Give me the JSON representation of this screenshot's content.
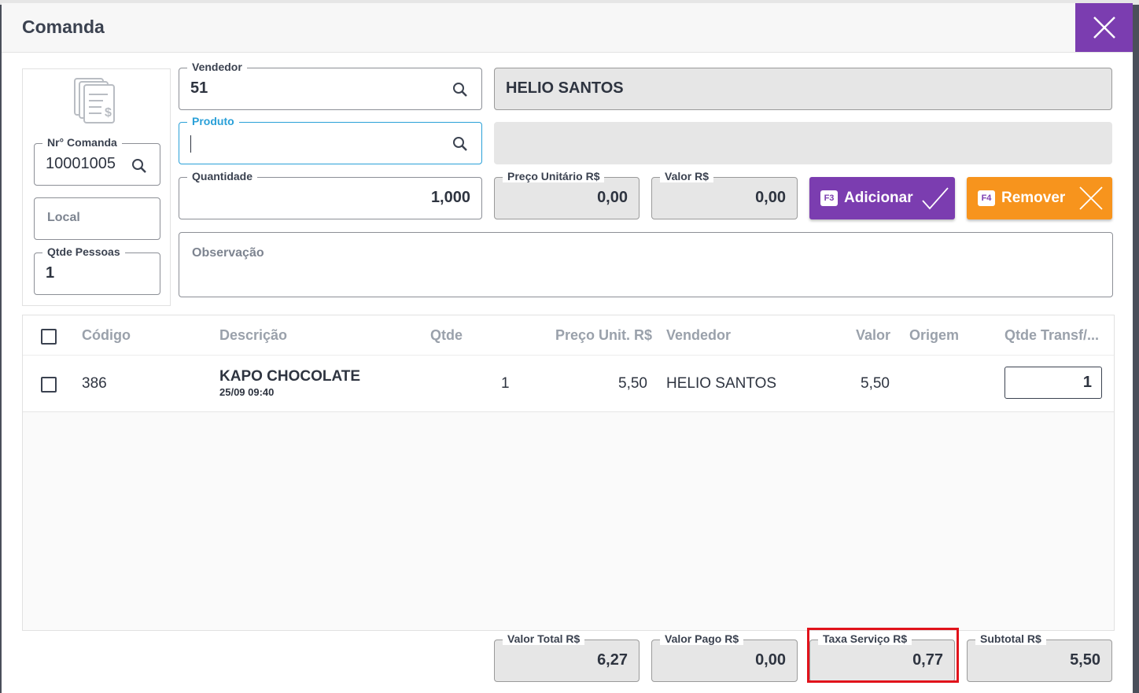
{
  "window": {
    "title": "Comanda"
  },
  "left_panel": {
    "comanda_label": "Nr° Comanda",
    "comanda_value": "10001005",
    "local_placeholder": "Local",
    "pessoas_label": "Qtde Pessoas",
    "pessoas_value": "1"
  },
  "form": {
    "vendedor_label": "Vendedor",
    "vendedor_value": "51",
    "vendedor_name": "HELIO SANTOS",
    "produto_label": "Produto",
    "produto_value": "",
    "produto_desc": "",
    "quantidade_label": "Quantidade",
    "quantidade_value": "1,000",
    "preco_label": "Preço Unitário R$",
    "preco_value": "0,00",
    "valor_label": "Valor R$",
    "valor_value": "0,00",
    "observacao_placeholder": "Observação"
  },
  "buttons": {
    "adicionar_key": "F3",
    "adicionar_label": "Adicionar",
    "remover_key": "F4",
    "remover_label": "Remover"
  },
  "table": {
    "columns": [
      "Código",
      "Descrição",
      "Qtde",
      "Preço Unit. R$",
      "Vendedor",
      "Valor",
      "Origem",
      "Qtde Transf/..."
    ],
    "rows": [
      {
        "codigo": "386",
        "descricao": "KAPO CHOCOLATE",
        "datahora": "25/09 09:40",
        "qtde": "1",
        "preco": "5,50",
        "vendedor": "HELIO SANTOS",
        "valor": "5,50",
        "origem": "",
        "qtde_transf": "1"
      }
    ]
  },
  "totals": {
    "valor_total_label": "Valor Total R$",
    "valor_total": "6,27",
    "valor_pago_label": "Valor Pago R$",
    "valor_pago": "0,00",
    "taxa_label": "Taxa Serviço R$",
    "taxa": "0,77",
    "subtotal_label": "Subtotal R$",
    "subtotal": "5,50"
  },
  "colors": {
    "accent_purple": "#7b3db0",
    "accent_orange": "#f7941d",
    "focus_blue": "#2aa0d8",
    "highlight_red": "#e1131b"
  },
  "icons": [
    "close-icon",
    "document-money-icon",
    "search-icon",
    "check-icon",
    "x-icon"
  ]
}
